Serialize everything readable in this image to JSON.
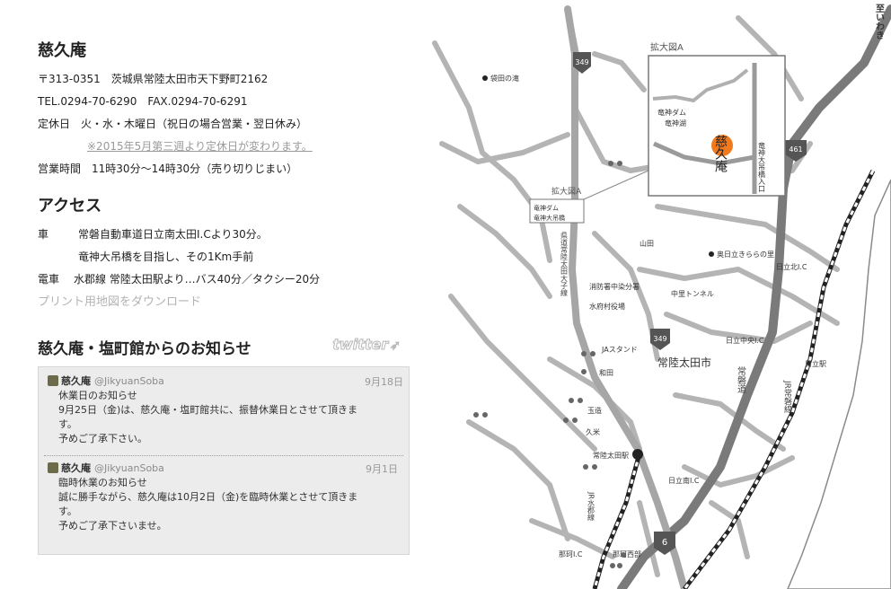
{
  "shop": {
    "name": "慈久庵",
    "address": "〒313-0351　茨城県常陸太田市天下野町2162",
    "tel_fax": "TEL.0294-70-6290　FAX.0294-70-6291",
    "closed_label": "定休日",
    "closed_value": "火・水・木曜日（祝日の場合営業・翌日休み）",
    "closed_note": "※2015年5月第三週より定休日が変わります。",
    "hours_label": "営業時間",
    "hours_value": "11時30分～14時30分（売り切りじまい）"
  },
  "access": {
    "title": "アクセス",
    "car_label": "車",
    "car_line1": "常磐自動車道日立南太田I.Cより30分。",
    "car_line2": "竜神大吊橋を目指し、その1Km手前",
    "train_label": "電車",
    "train_line": "水郡線 常陸太田駅より…バス40分／タクシー20分",
    "print_map_link": "プリント用地図をダウンロード"
  },
  "news": {
    "title": "慈久庵・塩町館からのお知らせ",
    "twitter_logo": "twitter",
    "tweets": [
      {
        "user": "慈久庵",
        "handle": "@JikyuanSoba",
        "date": "9月18日",
        "lines": [
          "休業日のお知らせ",
          "9月25日（金)は、慈久庵・塩町館共に、振替休業日とさせて頂きま",
          "す。",
          "予めご了承下さい。"
        ]
      },
      {
        "user": "慈久庵",
        "handle": "@JikyuanSoba",
        "date": "9月1日",
        "lines": [
          "臨時休業のお知らせ",
          "誠に勝手ながら、慈久庵は10月2日（金)を臨時休業とさせて頂きま",
          "す。",
          "予めご了承下さいませ。"
        ]
      }
    ]
  },
  "map": {
    "inset_title": "拡大図A",
    "inset_small_label": "拡大図A",
    "inset_dam": "竜神ダム",
    "inset_lake": "竜神湖",
    "inset_bridge_label": "竜神大吊橋入口",
    "inset_shop": "慈久庵",
    "box_dam": "竜神ダム",
    "box_bridge": "竜神大吊橋",
    "route_349": "349",
    "route_461": "461",
    "route_6": "6",
    "iwaki": "至いわき",
    "fukuroda": "袋田の滝",
    "yamada": "山田",
    "okutachi": "奥日立きららの里",
    "hitachi_kita": "日立北I.C",
    "prefectural_road": "県道常陸太田大子線",
    "fire_station": "消防署中染分署",
    "mizufu_office": "水府村役場",
    "nakasato_tunnel": "中里トンネル",
    "hitachi_chuo": "日立中央I.C",
    "ja_stand": "JAスタンド",
    "wada": "和田",
    "city": "常陸太田市",
    "hitachi_station": "日立駅",
    "tamazo": "玉造",
    "kume": "久米",
    "station": "常陸太田駅",
    "joban_expressway": "常磐道",
    "jr_joban_line": "JR常磐線",
    "suigun_line": "JR水郡線",
    "hitachi_minami": "日立南I.C",
    "naka_ic": "那珂I.C",
    "naka_interchange": "那珂西部",
    "colors": {
      "road": "#a9a9a9",
      "road_dark": "#6b6b6b",
      "shop_marker": "#f07a1e"
    }
  }
}
